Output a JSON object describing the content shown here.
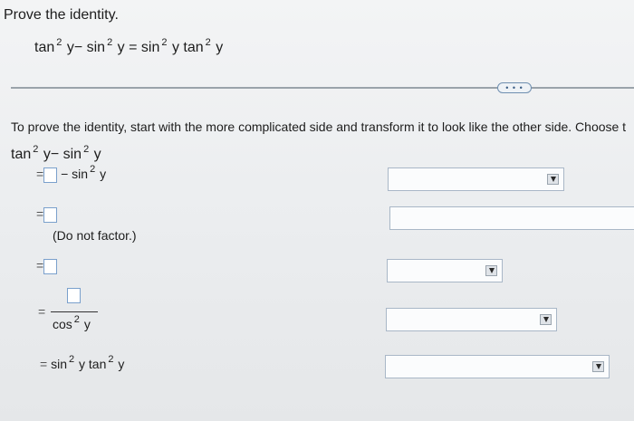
{
  "header": {
    "instruction": "Prove the identity.",
    "identity": {
      "f1": "tan",
      "e1": "2",
      "v1": "y",
      "op1": "−",
      "f2": "sin",
      "e2": "2",
      "v2": "y",
      "eq": "=",
      "f3": "sin",
      "e3": "2",
      "v3": "y",
      "f4": "tan",
      "e4": "2",
      "v4": "y"
    }
  },
  "expand_label": "• • •",
  "instructions_text": "To prove the identity, start with the more complicated side and transform it to look like the other side. Choose t",
  "steps": {
    "start": {
      "f1": "tan",
      "e1": "2",
      "v1": "y",
      "op": "−",
      "f2": "sin",
      "e2": "2",
      "v2": "y"
    },
    "step1": {
      "eq": "=",
      "op": "−",
      "f": "sin",
      "e": "2",
      "v": "y"
    },
    "step2": {
      "eq": "=",
      "note": "(Do not factor.)"
    },
    "step3": {
      "eq": "="
    },
    "step4": {
      "eq": "=",
      "den_f": "cos",
      "den_e": "2",
      "den_v": "y"
    },
    "step5": {
      "eq": "=",
      "f1": "sin",
      "e1": "2",
      "v1": "y",
      "f2": "tan",
      "e2": "2",
      "v2": "y"
    }
  },
  "dropdowns": [
    {
      "selected": ""
    },
    {
      "selected": ""
    },
    {
      "selected": ""
    },
    {
      "selected": ""
    },
    {
      "selected": ""
    }
  ]
}
